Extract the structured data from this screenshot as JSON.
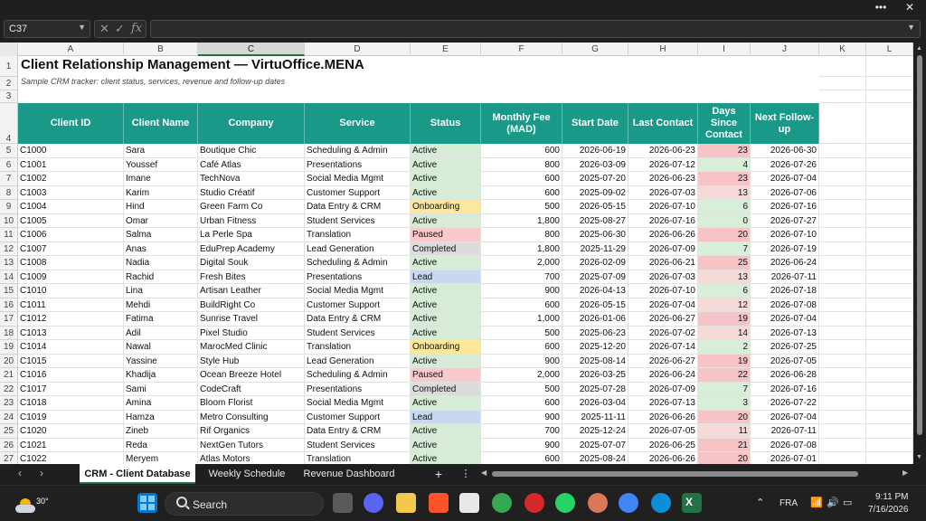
{
  "window": {
    "more_label": "•••",
    "close_label": "✕"
  },
  "formula_bar": {
    "name_box": "C37",
    "formula": "",
    "fx_label": "fx"
  },
  "columns": [
    "A",
    "B",
    "C",
    "D",
    "E",
    "F",
    "G",
    "H",
    "I",
    "J",
    "K",
    "L"
  ],
  "selected_column": "C",
  "sheet": {
    "title": "Client Relationship Management — VirtuOffice.MENA",
    "subtitle": "Sample CRM tracker: client status, services, revenue and follow-up dates",
    "headers": [
      "Client ID",
      "Client Name",
      "Company",
      "Service",
      "Status",
      "Monthly Fee (MAD)",
      "Start Date",
      "Last Contact",
      "Days Since Contact",
      "Next Follow-up"
    ],
    "row_numbers": [
      "1",
      "2",
      "3",
      "4",
      "5",
      "6",
      "7",
      "8",
      "9",
      "10",
      "11",
      "12",
      "13",
      "14",
      "15",
      "16",
      "17",
      "18",
      "19",
      "20",
      "21",
      "22",
      "23",
      "24",
      "25",
      "26",
      "27"
    ],
    "rows": [
      [
        "C1000",
        "Sara",
        "Boutique Chic",
        "Scheduling & Admin",
        "Active",
        "600",
        "2026-06-19",
        "2026-06-23",
        "23",
        "2026-06-30"
      ],
      [
        "C1001",
        "Youssef",
        "Café Atlas",
        "Presentations",
        "Active",
        "800",
        "2026-03-09",
        "2026-07-12",
        "4",
        "2026-07-26"
      ],
      [
        "C1002",
        "Imane",
        "TechNova",
        "Social Media Mgmt",
        "Active",
        "600",
        "2025-07-20",
        "2026-06-23",
        "23",
        "2026-07-04"
      ],
      [
        "C1003",
        "Karim",
        "Studio Créatif",
        "Customer Support",
        "Active",
        "600",
        "2025-09-02",
        "2026-07-03",
        "13",
        "2026-07-06"
      ],
      [
        "C1004",
        "Hind",
        "Green Farm Co",
        "Data Entry & CRM",
        "Onboarding",
        "500",
        "2026-05-15",
        "2026-07-10",
        "6",
        "2026-07-16"
      ],
      [
        "C1005",
        "Omar",
        "Urban Fitness",
        "Student Services",
        "Active",
        "1,800",
        "2025-08-27",
        "2026-07-16",
        "0",
        "2026-07-27"
      ],
      [
        "C1006",
        "Salma",
        "La Perle Spa",
        "Translation",
        "Paused",
        "800",
        "2025-06-30",
        "2026-06-26",
        "20",
        "2026-07-10"
      ],
      [
        "C1007",
        "Anas",
        "EduPrep Academy",
        "Lead Generation",
        "Completed",
        "1,800",
        "2025-11-29",
        "2026-07-09",
        "7",
        "2026-07-19"
      ],
      [
        "C1008",
        "Nadia",
        "Digital Souk",
        "Scheduling & Admin",
        "Active",
        "2,000",
        "2026-02-09",
        "2026-06-21",
        "25",
        "2026-06-24"
      ],
      [
        "C1009",
        "Rachid",
        "Fresh Bites",
        "Presentations",
        "Lead",
        "700",
        "2025-07-09",
        "2026-07-03",
        "13",
        "2026-07-11"
      ],
      [
        "C1010",
        "Lina",
        "Artisan Leather",
        "Social Media Mgmt",
        "Active",
        "900",
        "2026-04-13",
        "2026-07-10",
        "6",
        "2026-07-18"
      ],
      [
        "C1011",
        "Mehdi",
        "BuildRight Co",
        "Customer Support",
        "Active",
        "600",
        "2026-05-15",
        "2026-07-04",
        "12",
        "2026-07-08"
      ],
      [
        "C1012",
        "Fatima",
        "Sunrise Travel",
        "Data Entry & CRM",
        "Active",
        "1,000",
        "2026-01-06",
        "2026-06-27",
        "19",
        "2026-07-04"
      ],
      [
        "C1013",
        "Adil",
        "Pixel Studio",
        "Student Services",
        "Active",
        "500",
        "2025-06-23",
        "2026-07-02",
        "14",
        "2026-07-13"
      ],
      [
        "C1014",
        "Nawal",
        "MarocMed Clinic",
        "Translation",
        "Onboarding",
        "600",
        "2025-12-20",
        "2026-07-14",
        "2",
        "2026-07-25"
      ],
      [
        "C1015",
        "Yassine",
        "Style Hub",
        "Lead Generation",
        "Active",
        "900",
        "2025-08-14",
        "2026-06-27",
        "19",
        "2026-07-05"
      ],
      [
        "C1016",
        "Khadija",
        "Ocean Breeze Hotel",
        "Scheduling & Admin",
        "Paused",
        "2,000",
        "2026-03-25",
        "2026-06-24",
        "22",
        "2026-06-28"
      ],
      [
        "C1017",
        "Sami",
        "CodeCraft",
        "Presentations",
        "Completed",
        "500",
        "2025-07-28",
        "2026-07-09",
        "7",
        "2026-07-16"
      ],
      [
        "C1018",
        "Amina",
        "Bloom Florist",
        "Social Media Mgmt",
        "Active",
        "600",
        "2026-03-04",
        "2026-07-13",
        "3",
        "2026-07-22"
      ],
      [
        "C1019",
        "Hamza",
        "Metro Consulting",
        "Customer Support",
        "Lead",
        "900",
        "2025-11-11",
        "2026-06-26",
        "20",
        "2026-07-04"
      ],
      [
        "C1020",
        "Zineb",
        "Rif Organics",
        "Data Entry & CRM",
        "Active",
        "700",
        "2025-12-24",
        "2026-07-05",
        "11",
        "2026-07-11"
      ],
      [
        "C1021",
        "Reda",
        "NextGen Tutors",
        "Student Services",
        "Active",
        "900",
        "2025-07-07",
        "2026-06-25",
        "21",
        "2026-07-08"
      ],
      [
        "C1022",
        "Meryem",
        "Atlas Motors",
        "Translation",
        "Active",
        "600",
        "2025-08-24",
        "2026-06-26",
        "20",
        "2026-07-01"
      ]
    ]
  },
  "sheet_tabs": [
    "CRM - Client Database",
    "Weekly Schedule",
    "Revenue Dashboard"
  ],
  "sheet_tabs_add": "+",
  "sheet_tabs_more": "⋮",
  "taskbar": {
    "weather_temp": "30°",
    "search_label": "Search",
    "language": "FRA",
    "time": "9:11 PM",
    "date": "7/16/2026"
  },
  "status_colors": {
    "Active": "#d6ecd6",
    "Onboarding": "#fce79a",
    "Paused": "#f8c9cd",
    "Completed": "#dcdcdc",
    "Lead": "#c8d8f0"
  },
  "colors": {
    "header_teal": "#1a9988",
    "excel_green": "#217346"
  }
}
